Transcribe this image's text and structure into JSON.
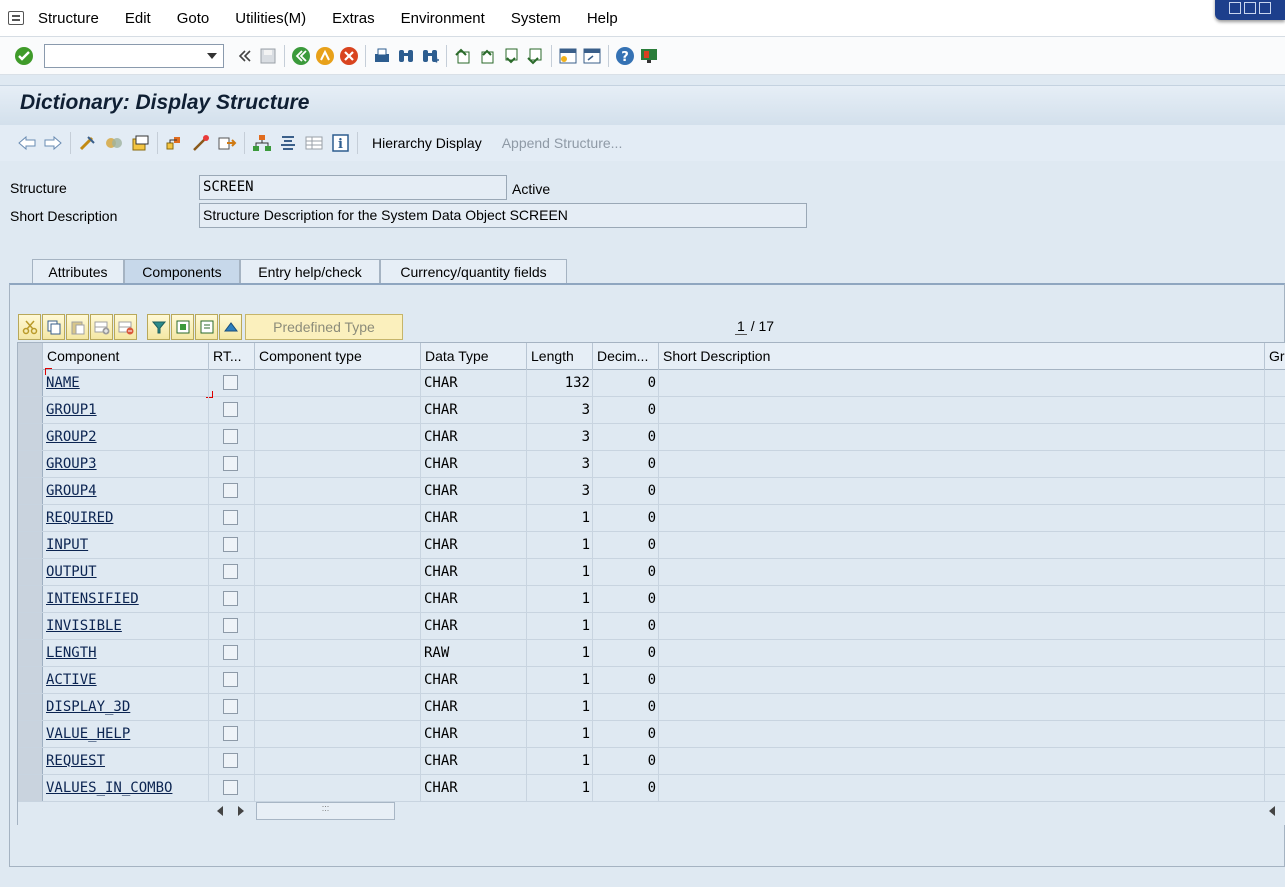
{
  "menubar": {
    "items": [
      "Structure",
      "Edit",
      "Goto",
      "Utilities(M)",
      "Extras",
      "Environment",
      "System",
      "Help"
    ]
  },
  "std_toolbar": {
    "command_value": "",
    "icons": [
      "enter-icon",
      "back-icon",
      "save-icon",
      "back-green-icon",
      "exit-icon",
      "cancel-icon",
      "print-icon",
      "find-icon",
      "find-next-icon",
      "first-page-icon",
      "previous-page-icon",
      "next-page-icon",
      "last-page-icon",
      "create-session-icon",
      "shortcut-icon",
      "help-icon",
      "customize-layout-icon"
    ]
  },
  "title": "Dictionary: Display Structure",
  "app_toolbar": {
    "hierarchy_label": "Hierarchy Display",
    "append_label": "Append Structure..."
  },
  "header": {
    "structure_label": "Structure",
    "structure_value": "SCREEN",
    "status": "Active",
    "short_desc_label": "Short Description",
    "short_desc_value": "Structure Description for the System Data Object SCREEN"
  },
  "tabs": [
    "Attributes",
    "Components",
    "Entry help/check",
    "Currency/quantity fields"
  ],
  "active_tab": "Components",
  "table_toolbar": {
    "predefined_label": "Predefined Type",
    "page_current": "1",
    "page_sep": "/",
    "page_total": "17"
  },
  "table": {
    "columns": [
      "Component",
      "RT...",
      "Component type",
      "Data Type",
      "Length",
      "Decim...",
      "Short Description",
      "Gr"
    ],
    "rows": [
      {
        "component": "NAME",
        "data_type": "CHAR",
        "length": "132",
        "decimals": "0"
      },
      {
        "component": "GROUP1",
        "data_type": "CHAR",
        "length": "3",
        "decimals": "0"
      },
      {
        "component": "GROUP2",
        "data_type": "CHAR",
        "length": "3",
        "decimals": "0"
      },
      {
        "component": "GROUP3",
        "data_type": "CHAR",
        "length": "3",
        "decimals": "0"
      },
      {
        "component": "GROUP4",
        "data_type": "CHAR",
        "length": "3",
        "decimals": "0"
      },
      {
        "component": "REQUIRED",
        "data_type": "CHAR",
        "length": "1",
        "decimals": "0"
      },
      {
        "component": "INPUT",
        "data_type": "CHAR",
        "length": "1",
        "decimals": "0"
      },
      {
        "component": "OUTPUT",
        "data_type": "CHAR",
        "length": "1",
        "decimals": "0"
      },
      {
        "component": "INTENSIFIED",
        "data_type": "CHAR",
        "length": "1",
        "decimals": "0"
      },
      {
        "component": "INVISIBLE",
        "data_type": "CHAR",
        "length": "1",
        "decimals": "0"
      },
      {
        "component": "LENGTH",
        "data_type": "RAW",
        "length": "1",
        "decimals": "0"
      },
      {
        "component": "ACTIVE",
        "data_type": "CHAR",
        "length": "1",
        "decimals": "0"
      },
      {
        "component": "DISPLAY_3D",
        "data_type": "CHAR",
        "length": "1",
        "decimals": "0"
      },
      {
        "component": "VALUE_HELP",
        "data_type": "CHAR",
        "length": "1",
        "decimals": "0"
      },
      {
        "component": "REQUEST",
        "data_type": "CHAR",
        "length": "1",
        "decimals": "0"
      },
      {
        "component": "VALUES_IN_COMBO",
        "data_type": "CHAR",
        "length": "1",
        "decimals": "0"
      }
    ]
  },
  "colors": {
    "background": "#dfe9f2",
    "title_text": "#0f1f33",
    "link": "#0b2451",
    "toolbar_button": "#f4e7a4"
  }
}
